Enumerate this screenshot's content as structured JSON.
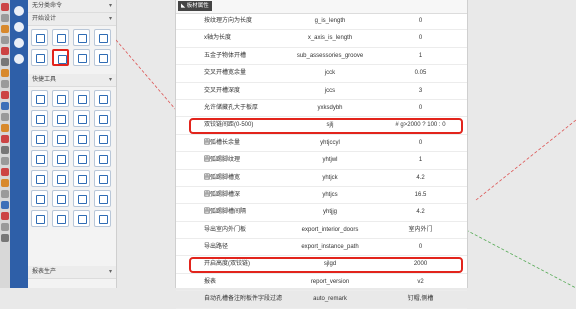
{
  "panel": {
    "header_top": "无分类命令",
    "section_design": "开始设计",
    "section_tools": "快捷工具",
    "section_report": "报表生产",
    "dropdown_glyph": "▾",
    "design_icon_count": 12,
    "tool_icon_count": 28
  },
  "dialog": {
    "title_chip": "◣ 板材属性"
  },
  "table": {
    "rows": [
      {
        "name": "按纹理方向为长度",
        "key": "g_is_length",
        "value": "0"
      },
      {
        "name": "x轴为长度",
        "key": "x_axis_is_length",
        "value": "0"
      },
      {
        "name": "五金子物体开槽",
        "key": "sub_assessories_groove",
        "value": "1"
      },
      {
        "name": "交叉开槽宽余量",
        "key": "jcck",
        "value": "0.05"
      },
      {
        "name": "交叉开槽深度",
        "key": "jccs",
        "value": "3"
      },
      {
        "name": "允许储藏孔大于板厚",
        "key": "yxksdybh",
        "value": "0"
      },
      {
        "name": "双铰链间距(0-500)",
        "key": "sjlj",
        "value": "# g>2000 ? 100 : 0",
        "highlight": true
      },
      {
        "name": "圆弧槽长余量",
        "key": "yhtjccyl",
        "value": "0"
      },
      {
        "name": "圆弧踢脚纹理",
        "key": "yhtjwl",
        "value": "1"
      },
      {
        "name": "圆弧踢脚槽宽",
        "key": "yhtjck",
        "value": "4.2"
      },
      {
        "name": "圆弧踢脚槽深",
        "key": "yhtjcs",
        "value": "16.5"
      },
      {
        "name": "圆弧踢脚槽间隔",
        "key": "yhtjjg",
        "value": "4.2"
      },
      {
        "name": "导出室内外门板",
        "key": "export_interior_doors",
        "value": "室内外门"
      },
      {
        "name": "导出路径",
        "key": "export_instance_path",
        "value": "0"
      },
      {
        "name": "开启高度(双铰链)",
        "key": "sjlgd",
        "value": "2000",
        "highlight": true
      },
      {
        "name": "报表",
        "key": "report_version",
        "value": "v2"
      },
      {
        "name": "自动孔槽备注附板件字段过滤",
        "key": "auto_remark",
        "value": "钉帽,侧槽"
      }
    ]
  },
  "colors": {
    "highlight": "#e2241c",
    "sidebar_blue": "#2e5fa8",
    "icon_blue": "#2f6cb4"
  }
}
